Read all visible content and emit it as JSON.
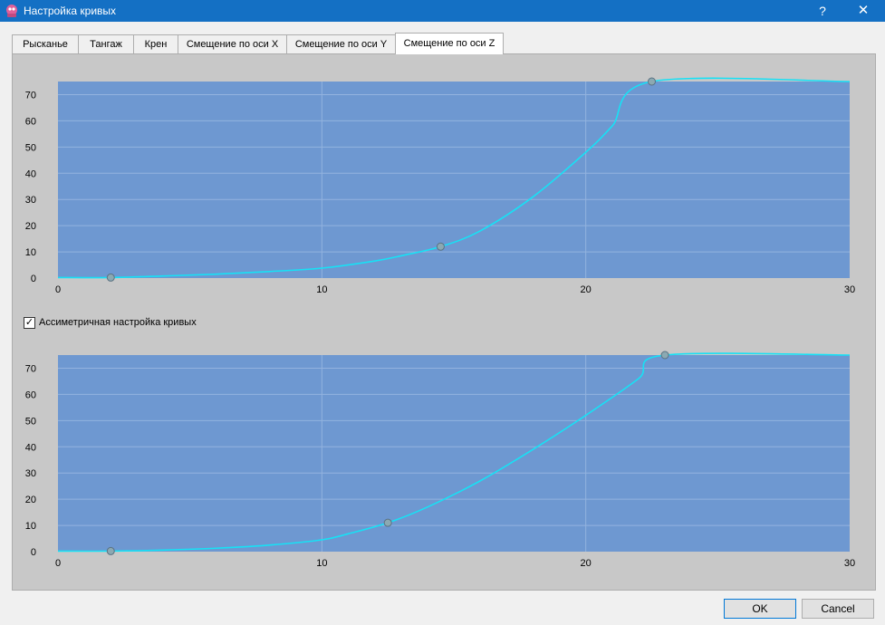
{
  "window": {
    "title": "Настройка кривых",
    "help_label": "?",
    "close_label": "✕",
    "icon": "app-icon"
  },
  "tabs": [
    {
      "label": "Рысканье",
      "active": false
    },
    {
      "label": "Тангаж",
      "active": false
    },
    {
      "label": "Крен",
      "active": false
    },
    {
      "label": "Смещение по оси X",
      "active": false
    },
    {
      "label": "Смещение по оси Y",
      "active": false
    },
    {
      "label": "Смещение по оси Z",
      "active": true
    }
  ],
  "checkbox": {
    "label": "Ассиметричная настройка кривых",
    "checked": true,
    "mark": "✓"
  },
  "buttons": {
    "ok": "OK",
    "cancel": "Cancel"
  },
  "colors": {
    "plot_bg": "#6e98d1",
    "grid": "#93b3df",
    "curve": "#17e1f5",
    "point_fill": "#8ca9b2",
    "point_stroke": "#5a7282"
  },
  "chart_data": [
    {
      "type": "line",
      "title": "",
      "xlabel": "",
      "ylabel": "",
      "xlim": [
        0,
        30
      ],
      "ylim": [
        0,
        75
      ],
      "xticks": [
        0,
        10,
        20,
        30
      ],
      "yticks": [
        0,
        10,
        20,
        30,
        40,
        50,
        60,
        70
      ],
      "grid": true,
      "control_points": [
        [
          2,
          0.2
        ],
        [
          14.5,
          12
        ],
        [
          22.5,
          75
        ]
      ],
      "series": [
        {
          "x": [
            0,
            2,
            4,
            6,
            8,
            10,
            12,
            13,
            14.5,
            16,
            18,
            20,
            21,
            22.5,
            30
          ],
          "y": [
            0.2,
            0.2,
            0.8,
            1.5,
            2.5,
            3.8,
            6.5,
            8.5,
            12,
            18,
            31,
            48,
            58,
            75,
            75
          ]
        }
      ]
    },
    {
      "type": "line",
      "title": "",
      "xlabel": "",
      "ylabel": "",
      "xlim": [
        0,
        30
      ],
      "ylim": [
        0,
        75
      ],
      "xticks": [
        0,
        10,
        20,
        30
      ],
      "yticks": [
        0,
        10,
        20,
        30,
        40,
        50,
        60,
        70
      ],
      "grid": true,
      "control_points": [
        [
          2,
          0.2
        ],
        [
          12.5,
          11
        ],
        [
          23,
          75
        ]
      ],
      "series": [
        {
          "x": [
            0,
            2,
            4,
            6,
            8,
            10,
            11,
            12.5,
            14,
            16,
            18,
            20,
            22,
            23,
            30
          ],
          "y": [
            0.2,
            0.2,
            0.6,
            1.3,
            2.5,
            4.5,
            6.8,
            11,
            17,
            27,
            39,
            52,
            66,
            75,
            75
          ]
        }
      ]
    }
  ]
}
